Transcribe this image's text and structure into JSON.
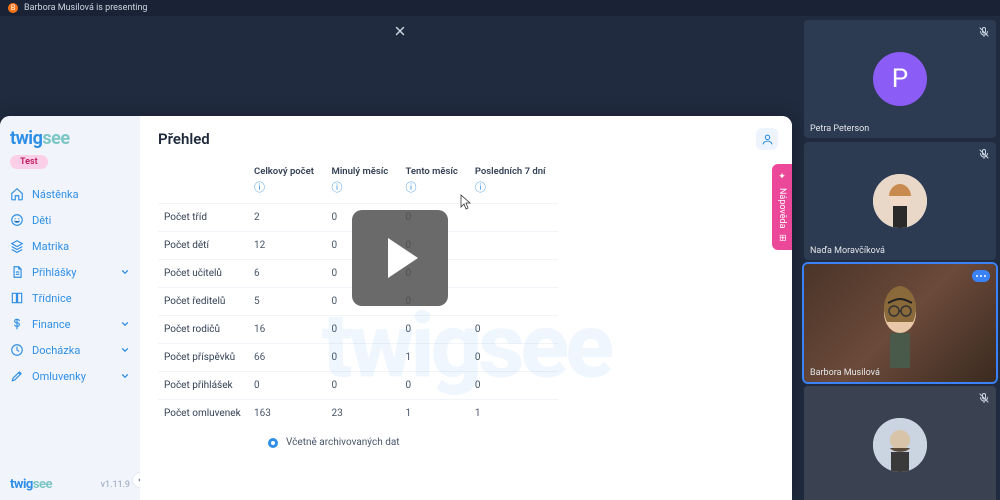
{
  "presenter": {
    "initial": "B",
    "status": "Barbora Musilová is presenting"
  },
  "app": {
    "logo_a": "twig",
    "logo_b": "see",
    "env_badge": "Test",
    "version": "v1.11.9",
    "page_title": "Přehled",
    "help_label": "Nápověda",
    "watermark": "twigsee"
  },
  "nav": [
    {
      "icon": "home",
      "label": "Nástěnka",
      "expand": false
    },
    {
      "icon": "smile",
      "label": "Děti",
      "expand": false
    },
    {
      "icon": "layers",
      "label": "Matrika",
      "expand": false
    },
    {
      "icon": "file",
      "label": "Přihlášky",
      "expand": true
    },
    {
      "icon": "book",
      "label": "Třídnice",
      "expand": false
    },
    {
      "icon": "dollar",
      "label": "Finance",
      "expand": true
    },
    {
      "icon": "clock",
      "label": "Docházka",
      "expand": true
    },
    {
      "icon": "edit",
      "label": "Omluvenky",
      "expand": true
    }
  ],
  "table": {
    "columns": [
      "",
      "Celkový počet",
      "Minulý měsíc",
      "Tento měsíc",
      "Posledních 7 dní"
    ],
    "rows": [
      {
        "label": "Počet tříd",
        "vals": [
          "2",
          "0",
          "0",
          ""
        ]
      },
      {
        "label": "Počet dětí",
        "vals": [
          "12",
          "0",
          "0",
          ""
        ]
      },
      {
        "label": "Počet učitelů",
        "vals": [
          "6",
          "0",
          "0",
          ""
        ]
      },
      {
        "label": "Počet ředitelů",
        "vals": [
          "5",
          "0",
          "0",
          ""
        ]
      },
      {
        "label": "Počet rodičů",
        "vals": [
          "16",
          "0",
          "0",
          "0"
        ]
      },
      {
        "label": "Počet příspěvků",
        "vals": [
          "66",
          "0",
          "1",
          "0"
        ]
      },
      {
        "label": "Počet přihlášek",
        "vals": [
          "0",
          "0",
          "0",
          "0"
        ]
      },
      {
        "label": "Počet omluvenek",
        "vals": [
          "163",
          "23",
          "1",
          "1"
        ]
      }
    ],
    "archive_label": "Včetně archivovaných dat"
  },
  "participants": [
    {
      "kind": "letter",
      "initial": "P",
      "name": "Petra Peterson",
      "muted": true,
      "active": false
    },
    {
      "kind": "photo",
      "name": "Naďa Moravčíková",
      "muted": true,
      "active": false
    },
    {
      "kind": "video",
      "name": "Barbora Musilová",
      "muted": false,
      "active": true
    },
    {
      "kind": "photo2",
      "name": "",
      "muted": true,
      "active": false
    }
  ]
}
